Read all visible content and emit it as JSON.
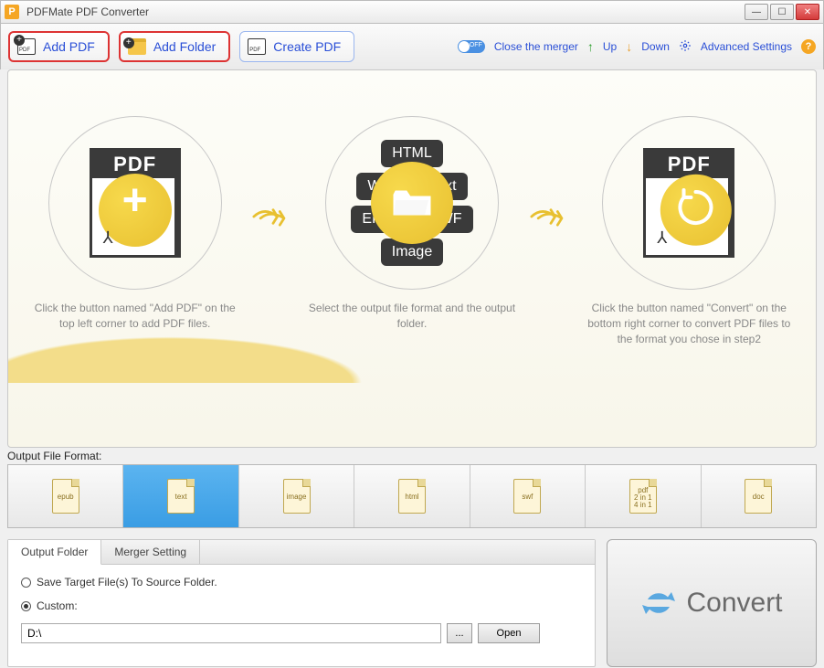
{
  "window": {
    "title": "PDFMate PDF Converter"
  },
  "toolbar": {
    "add_pdf": "Add PDF",
    "add_folder": "Add Folder",
    "create_pdf": "Create PDF",
    "close_merger": "Close the merger",
    "up": "Up",
    "down": "Down",
    "advanced": "Advanced Settings"
  },
  "steps": {
    "s1_pdf": "PDF",
    "s1_text": "Click the button named \"Add PDF\" on the top left corner to add PDF files.",
    "s2_text": "Select the output file format and the output folder.",
    "s2_chips": {
      "html": "HTML",
      "word": "Word",
      "text": "Text",
      "epub": "EPUB",
      "swf": "SWF",
      "image": "Image"
    },
    "s3_pdf": "PDF",
    "s3_text": "Click the button named \"Convert\" on the bottom right corner to convert PDF files to the format you chose in step2"
  },
  "formats": {
    "label": "Output File Format:",
    "items": [
      "epub",
      "text",
      "image",
      "html",
      "swf",
      "pdf\n2 in 1\n4 in 1",
      "doc"
    ],
    "selected_index": 1
  },
  "output": {
    "tab_folder": "Output Folder",
    "tab_merger": "Merger Setting",
    "save_to_source": "Save Target File(s) To Source Folder.",
    "custom_label": "Custom:",
    "path": "D:\\",
    "browse": "...",
    "open": "Open",
    "selected_radio": "custom"
  },
  "convert": {
    "label": "Convert"
  }
}
